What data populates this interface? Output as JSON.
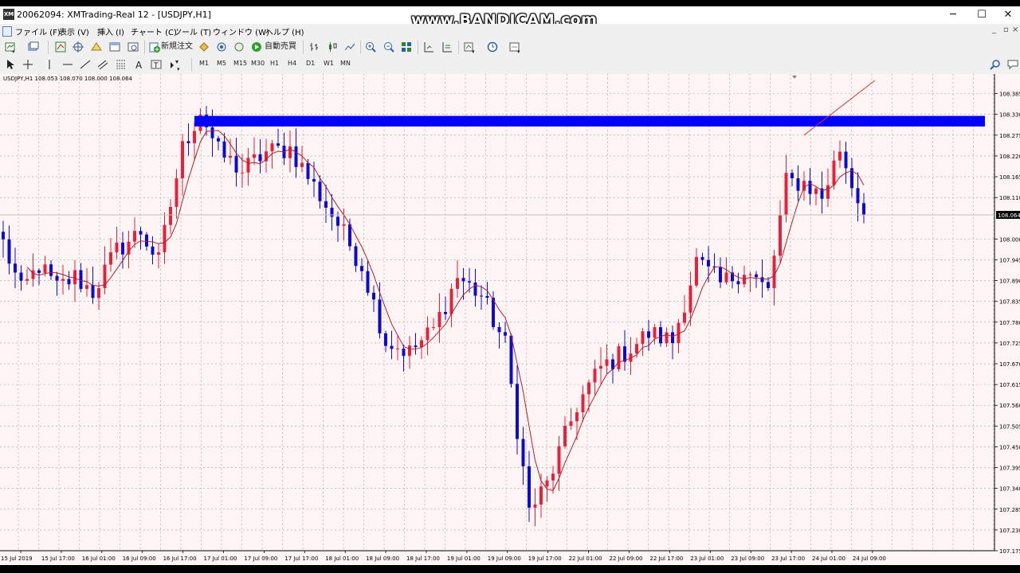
{
  "window": {
    "title": "20062094: XMTrading-Real 12 - [USDJPY,H1]",
    "app_icon_text": "XM",
    "watermark": "www.BANDICAM.com",
    "minimize_symbol": "─",
    "maximize_symbol": "☐",
    "close_symbol": "✕"
  },
  "menu": {
    "items": [
      "ファイル (F)",
      "表示 (V)",
      "挿入 (I)",
      "チャート (C)",
      "ツール (T)",
      "ウィンドウ (W)",
      "ヘルプ (H)"
    ],
    "mdi_minimize": "_",
    "mdi_restore": "▫",
    "mdi_close": "×"
  },
  "toolbar": {
    "new_order": "新規注文",
    "auto_trading": "自動売買"
  },
  "timeframes": [
    "M1",
    "M5",
    "M15",
    "M30",
    "H1",
    "H4",
    "D1",
    "W1",
    "MN"
  ],
  "chart_info": "USDJPY,H1  108.053 108.070 108.000 108.064",
  "colors": {
    "background": "#fff5f5",
    "grid": "#a0a0a0",
    "bull_candle": "#e8203a",
    "bear_candle": "#0a0ad4",
    "ma_line": "#b0202a",
    "resistance_rect": "#0000ff",
    "trendline": "#e0303a",
    "current_price_line": "#c0c0c0"
  },
  "chart_data": {
    "type": "candlestick",
    "symbol": "USDJPY",
    "timeframe": "H1",
    "ylim": [
      107.175,
      108.42
    ],
    "y_ticks": [
      108.385,
      108.33,
      108.275,
      108.22,
      108.165,
      108.11,
      108.0,
      107.945,
      107.89,
      107.835,
      107.78,
      107.725,
      107.67,
      107.615,
      107.56,
      107.505,
      107.45,
      107.395,
      107.34,
      107.285,
      107.23,
      107.175
    ],
    "y_tick_labels": [
      "108.385",
      "108.330",
      "108.275",
      "108.220",
      "108.165",
      "108.110",
      "108.000",
      "107.945",
      "107.890",
      "107.835",
      "107.780",
      "107.725",
      "107.670",
      "107.615",
      "107.560",
      "107.505",
      "107.450",
      "107.395",
      "107.340",
      "107.285",
      "107.230",
      "107.175"
    ],
    "current_price": 108.064,
    "current_price_label": "108.064",
    "x_labels": [
      "15 Jul 2019",
      "15 Jul 17:00",
      "16 Jul 01:00",
      "16 Jul 09:00",
      "16 Jul 17:00",
      "17 Jul 01:00",
      "17 Jul 09:00",
      "17 Jul 17:00",
      "18 Jul 01:00",
      "18 Jul 09:00",
      "18 Jul 17:00",
      "19 Jul 01:00",
      "19 Jul 09:00",
      "19 Jul 17:00",
      "22 Jul 01:00",
      "22 Jul 09:00",
      "22 Jul 17:00",
      "23 Jul 01:00",
      "23 Jul 09:00",
      "23 Jul 17:00",
      "24 Jul 01:00",
      "24 Jul 09:00"
    ],
    "bar_count": 145,
    "pivots": [
      [
        0,
        107.99
      ],
      [
        3,
        107.86
      ],
      [
        6,
        107.93
      ],
      [
        9,
        107.87
      ],
      [
        12,
        107.9
      ],
      [
        15,
        107.86
      ],
      [
        19,
        107.97
      ],
      [
        23,
        108.02
      ],
      [
        26,
        107.94
      ],
      [
        30,
        108.24
      ],
      [
        33,
        108.34
      ],
      [
        36,
        108.23
      ],
      [
        40,
        108.18
      ],
      [
        44,
        108.23
      ],
      [
        48,
        108.24
      ],
      [
        52,
        108.14
      ],
      [
        56,
        108.04
      ],
      [
        60,
        107.93
      ],
      [
        64,
        107.73
      ],
      [
        68,
        107.7
      ],
      [
        72,
        107.76
      ],
      [
        76,
        107.9
      ],
      [
        80,
        107.85
      ],
      [
        84,
        107.72
      ],
      [
        88,
        107.28
      ],
      [
        91,
        107.35
      ],
      [
        96,
        107.56
      ],
      [
        100,
        107.66
      ],
      [
        104,
        107.7
      ],
      [
        108,
        107.75
      ],
      [
        112,
        107.73
      ],
      [
        116,
        107.94
      ],
      [
        120,
        107.88
      ],
      [
        124,
        107.92
      ],
      [
        128,
        107.86
      ],
      [
        131,
        108.15
      ],
      [
        134,
        108.15
      ],
      [
        137,
        108.11
      ],
      [
        140,
        108.24
      ],
      [
        144,
        108.06
      ]
    ],
    "resistance_zone": {
      "from_label": "16 Jul 17:00",
      "price_low": 108.298,
      "price_high": 108.326
    },
    "trendline": {
      "from_price": 108.275,
      "to_price": 108.42
    }
  }
}
